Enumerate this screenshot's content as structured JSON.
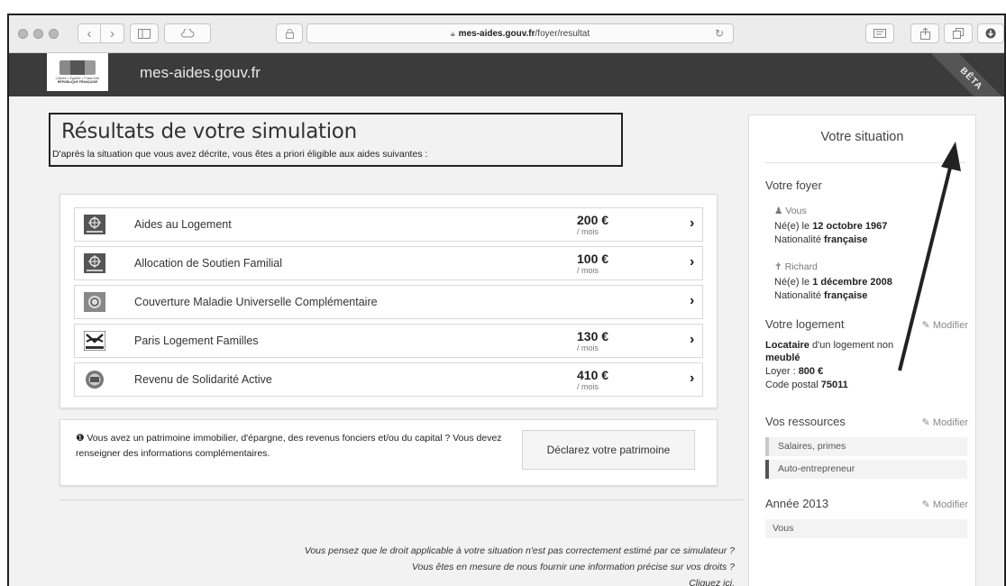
{
  "browser": {
    "url_domain": "mes-aides.gouv.fr",
    "url_path": "/foyer/resultat",
    "icons": [
      "back-icon",
      "forward-icon",
      "sidebar-icon",
      "cloud-icon",
      "lock-icon",
      "reload-icon",
      "reader-icon",
      "share-icon",
      "tabs-icon",
      "download-icon"
    ]
  },
  "header": {
    "site_name": "mes-aides.gouv.fr",
    "logo_text": "Liberté • Égalité • Fraternité",
    "logo_rf": "RÉPUBLIQUE FRANÇAISE",
    "beta": "BÊTA"
  },
  "results": {
    "title": "Résultats de votre simulation",
    "subtitle": "D'après la situation que vous avez décrite, vous êtes a priori éligible aux aides suivantes :"
  },
  "aids": [
    {
      "name": "Aides au Logement",
      "amount": "200 €",
      "period": "/ mois",
      "icon": "caf-logo-icon"
    },
    {
      "name": "Allocation de Soutien Familial",
      "amount": "100 €",
      "period": "/ mois",
      "icon": "caf-logo-icon"
    },
    {
      "name": "Couverture Maladie Universelle Complémentaire",
      "amount": "",
      "period": "",
      "icon": "cmu-logo-icon"
    },
    {
      "name": "Paris Logement Familles",
      "amount": "130 €",
      "period": "/ mois",
      "icon": "paris-logo-icon"
    },
    {
      "name": "Revenu de Solidarité Active",
      "amount": "410 €",
      "period": "/ mois",
      "icon": "rsa-logo-icon"
    }
  ],
  "patrimoine": {
    "text": "Vous avez un patrimoine immobilier, d'épargne, des revenus fonciers et/ou du capital ? Vous devez renseigner des informations complémentaires.",
    "button": "Déclarez votre patrimoine"
  },
  "feedback": {
    "line1": "Vous pensez que le droit applicable à votre situation n'est pas correctement estimé par ce simulateur ?",
    "line2": "Vous êtes en mesure de nous fournir une information précise sur vos droits ?",
    "line3": "Cliquez ici."
  },
  "sidebar": {
    "title": "Votre situation",
    "foyer": {
      "heading": "Votre foyer",
      "p1_name": "Vous",
      "p1_born_prefix": "Né(e) le ",
      "p1_born": "12 octobre 1967",
      "p1_nat_prefix": "Nationalité ",
      "p1_nat": "française",
      "p2_name": "Richard",
      "p2_born_prefix": "Né(e) le ",
      "p2_born": "1 décembre 2008",
      "p2_nat_prefix": "Nationalité ",
      "p2_nat": "française"
    },
    "logement": {
      "heading": "Votre logement",
      "modify": "Modifier",
      "type_bold": "Locataire",
      "type_rest": " d'un logement non",
      "meuble": "meublé",
      "loyer_prefix": "Loyer : ",
      "loyer": "800 €",
      "cp_prefix": "Code postal ",
      "cp": "75011"
    },
    "ressources": {
      "heading": "Vos ressources",
      "modify": "Modifier",
      "items": [
        "Salaires, primes",
        "Auto-entrepreneur"
      ]
    },
    "annee": {
      "heading": "Année 2013",
      "modify": "Modifier",
      "items": [
        "Vous"
      ]
    }
  }
}
